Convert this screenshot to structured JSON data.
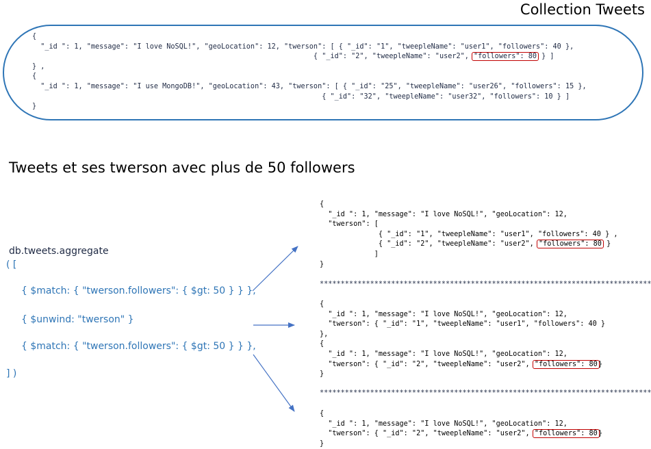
{
  "title": "Collection Tweets",
  "subtitle": "Tweets et ses twerson avec plus de 50 followers",
  "collection": {
    "doc1": {
      "open": "{",
      "line1": "  \"_id \": 1, \"message\": \"I love NoSQL!\", \"geoLocation\": 12, \"twerson\": [ { \"_id\": \"1\", \"tweepleName\": \"user1\", \"followers\": 40 },",
      "line2_pre": "                                                                   { \"_id\": \"2\", \"tweepleName\": \"user2\", ",
      "line2_hl": "\"followers\": 80",
      "line2_post": " } ]",
      "close": "} ,"
    },
    "doc2": {
      "open": "{",
      "line1": "  \"_id \": 1, \"message\": \"I use MongoDB!\", \"geoLocation\": 43, \"twerson\": [ { \"_id\": \"25\", \"tweepleName\": \"user26\", \"followers\": 15 },",
      "line2": "                                                                     { \"_id\": \"32\", \"tweepleName\": \"user32\", \"followers\": 10 } ]",
      "close": "}"
    }
  },
  "aggregate": {
    "call": "db.tweets.aggregate",
    "open": "( [",
    "stage1": "{ $match: { \"twerson.followers\": { $gt: 50 } } },",
    "stage2": "{ $unwind: \"twerson\" }",
    "stage3": "{ $match: { \"twerson.followers\": { $gt: 50 } } },",
    "close": "] )"
  },
  "result1": {
    "l1": "{",
    "l2": "  \"_id \": 1, \"message\": \"I love NoSQL!\", \"geoLocation\": 12,",
    "l3": "  \"twerson\": [",
    "l4_pre": "              { \"_id\": \"1\", \"tweepleName\": \"user1\", ",
    "l4_hl": "\"followers\": 40",
    "l4_post": " } ,",
    "l5_pre": "              { \"_id\": \"2\", \"tweepleName\": \"user2\", ",
    "l5_hl": "\"followers\": 80",
    "l5_post": " }",
    "l6": "             ]",
    "l7": "}"
  },
  "separator": "*************************************************************************************",
  "result2": {
    "l1": "{",
    "l2": "  \"_id \": 1, \"message\": \"I love NoSQL!\", \"geoLocation\": 12,",
    "l3": "  \"twerson\": { \"_id\": \"1\", \"tweepleName\": \"user1\", \"followers\": 40 }",
    "l4": "},",
    "l5": "{",
    "l6": "  \"_id \": 1, \"message\": \"I love NoSQL!\", \"geoLocation\": 12,",
    "l7_pre": "  \"twerson\": { \"_id\": \"2\", \"tweepleName\": \"user2\", ",
    "l7_hl": "\"followers\": 80",
    "l7_post": "}",
    "l8": "}"
  },
  "result3": {
    "l1": "{",
    "l2": "  \"_id \": 1, \"message\": \"I love NoSQL!\", \"geoLocation\": 12,",
    "l3_pre": "  \"twerson\": { \"_id\": \"2\", \"tweepleName\": \"user2\", ",
    "l3_hl": "\"followers\": 80",
    "l3_post": "}",
    "l4": "}"
  },
  "colors": {
    "box_border": "#2e75b6",
    "arrow": "#4472c4",
    "highlight": "#c00000",
    "code_text": "#1f2a44",
    "aggregate_text": "#2e75b6"
  }
}
